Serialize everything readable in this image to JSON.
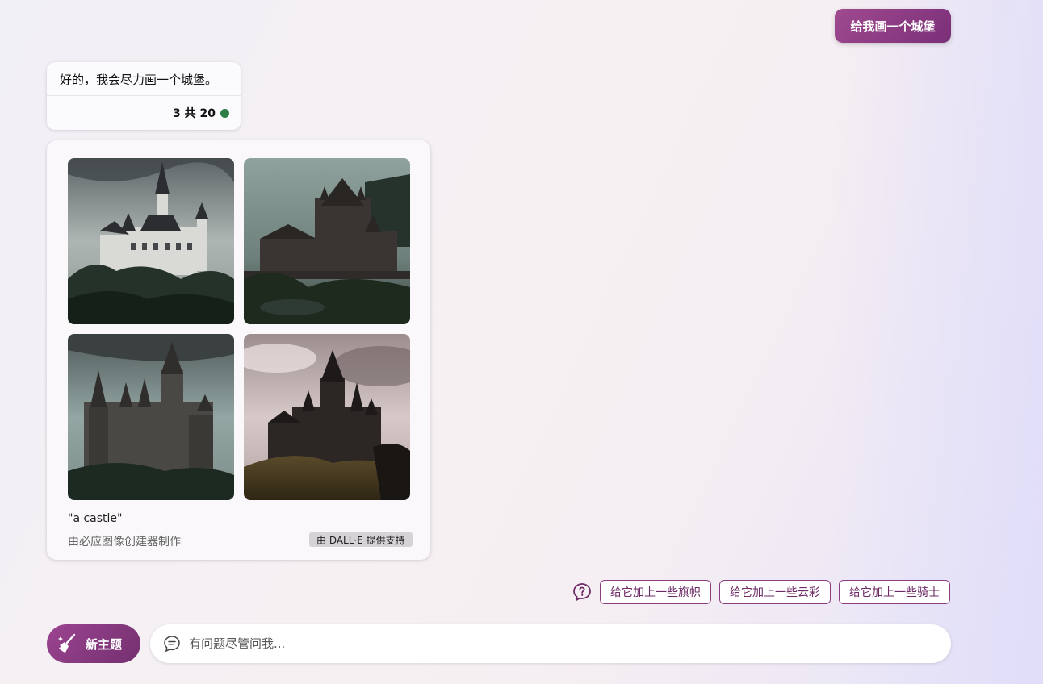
{
  "user_message": "给我画一个城堡",
  "bot_reply": {
    "text": "好的，我会尽力画一个城堡。",
    "turn_counter": "3 共 20"
  },
  "image_result": {
    "prompt": "\"a castle\"",
    "creator": "由必应图像创建器制作",
    "powered_by": "由 DALL·E 提供支持",
    "images": [
      "castle-image-1",
      "castle-image-2",
      "castle-image-3",
      "castle-image-4"
    ]
  },
  "suggestions": [
    "给它加上一些旗帜",
    "给它加上一些云彩",
    "给它加上一些骑士"
  ],
  "composer": {
    "new_topic_label": "新主题",
    "input_placeholder": "有问题尽管问我..."
  },
  "colors": {
    "accent": "#8b3d82",
    "status_dot": "#2e7d46"
  }
}
